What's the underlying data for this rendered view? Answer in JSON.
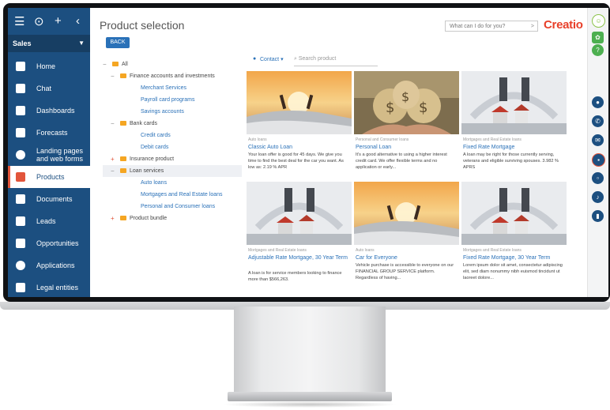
{
  "sidebar": {
    "workspace": "Sales",
    "items": [
      {
        "label": "Home"
      },
      {
        "label": "Chat"
      },
      {
        "label": "Dashboards"
      },
      {
        "label": "Forecasts"
      },
      {
        "label": "Landing pages and web forms"
      },
      {
        "label": "Products"
      },
      {
        "label": "Documents"
      },
      {
        "label": "Leads"
      },
      {
        "label": "Opportunities"
      },
      {
        "label": "Applications"
      },
      {
        "label": "Legal entities"
      }
    ],
    "active": "Products"
  },
  "header": {
    "title": "Product selection",
    "back": "BACK",
    "command_placeholder": "What can I do for you?",
    "logo": "Creatio"
  },
  "tree": [
    {
      "label": "All"
    },
    {
      "label": "Finance accounts and investments"
    },
    {
      "label": "Merchant Services"
    },
    {
      "label": "Payroll card programs"
    },
    {
      "label": "Savings accounts"
    },
    {
      "label": "Bank cards"
    },
    {
      "label": "Credit cards"
    },
    {
      "label": "Debit cards"
    },
    {
      "label": "Insurance product"
    },
    {
      "label": "Loan services"
    },
    {
      "label": "Auto loans"
    },
    {
      "label": "Mortgages and Real Estate loans"
    },
    {
      "label": "Personal and Consumer loans"
    },
    {
      "label": "Product bundle"
    }
  ],
  "filter": {
    "contact": "Contact",
    "search_placeholder": "Search product"
  },
  "cards": [
    {
      "category": "Auto loans",
      "title": "Classic Auto Loan",
      "desc": "Your loan offer is good for 45 days. We give you time to find the best deal for the car you want. As low as: 2.19 % APR"
    },
    {
      "category": "Personal and Consumer loans",
      "title": "Personal Loan",
      "desc": "It's a good alternative to using a higher interest credit card. We offer flexible terms and no application or early..."
    },
    {
      "category": "Mortgages and Real Estate loans",
      "title": "Fixed Rate Mortgage",
      "desc": "A loan may be right for those currently serving, veterans and eligible surviving spouses. 3.982 % APRS"
    },
    {
      "category": "Mortgages and Real Estate loans",
      "title": "Adjustable Rate Mortgage, 30 Year Term",
      "desc": "A loan is for service members looking to finance more than $566,263."
    },
    {
      "category": "Auto loans",
      "title": "Car for Everyone",
      "desc": "Vehicle purchase is accessible to everyone on our FINANCIAL GROUP SERVICE platform. Regardless of having..."
    },
    {
      "category": "Mortgages and Real Estate loans",
      "title": "Fixed Rate Mortgage, 30 Year Term",
      "desc": "Lorem ipsum dolor sit amet, consectetur adipiscing elit, sed diam nonummy nibh euismod tincidunt ut laoreet dolore..."
    }
  ],
  "colors": {
    "sidebar": "#1c4f80",
    "accent": "#e2553b",
    "link": "#2a71b8",
    "logo": "#e8402a"
  }
}
